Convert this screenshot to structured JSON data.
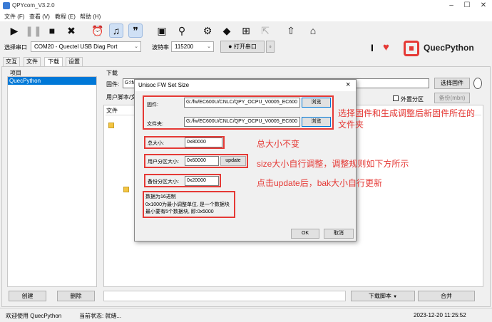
{
  "app": {
    "title": "QPYcom_V3.2.0",
    "window_controls": [
      "minimize-icon",
      "maximize-icon",
      "close-icon"
    ]
  },
  "menu": [
    "文件 (F)",
    "查看 (V)",
    "教程 (E)",
    "帮助 (H)"
  ],
  "toolbar_icons": [
    "play-icon",
    "pause-icon",
    "stop-icon",
    "close-x-icon",
    "alarm-icon",
    "headset-icon",
    "quote-icon",
    "save-icon",
    "search-icon",
    "gear-icon",
    "cube-icon",
    "plus-icon",
    "export-icon",
    "upload-icon",
    "toolbox-icon"
  ],
  "port": {
    "label": "选择串口",
    "value": "COM20 - Quectel USB Diag Port",
    "baud_label": "波特率",
    "baud_value": "115200",
    "open_button": "打开串口"
  },
  "brand": {
    "name": "QuecPython",
    "accent_color": "#e53935"
  },
  "tabs": [
    "交互",
    "文件",
    "下载",
    "设置"
  ],
  "selected_tab": "下载",
  "left_panel": {
    "header": "项目",
    "items": [
      "QuecPython"
    ],
    "create_button": "创建",
    "delete_button": "删除"
  },
  "download_panel": {
    "header": "下载",
    "firmware_label": "固件:",
    "firmware_value": "G:\\fv",
    "select_firmware_button": "选择固件",
    "scripts_label": "用户脚本/文",
    "backup_checkbox": "外置分区",
    "backup_button": "备份(mbn)",
    "file_header": "文件",
    "download_script_button": "下载脚本",
    "merge_button": "合并"
  },
  "dialog": {
    "title": "Unisoc FW Set Size",
    "firmware_label": "固件:",
    "firmware_path": "G:/fw/EC600U/CNLC/QPY_OCPU_V0005_EC600",
    "folder_label": "文件夹:",
    "folder_path": "G:/fw/EC600U/CNLC/QPY_OCPU_V0005_EC600",
    "browse_label": "浏览",
    "total_label": "总大小:",
    "total_value": "0x80000",
    "user_partition_label": "用户分区大小:",
    "user_partition_value": "0x60000",
    "update_button": "update",
    "backup_partition_label": "备份分区大小:",
    "backup_partition_value": "0x20000",
    "note_lines": [
      "数据为16进制",
      "0x1000为最小调整单位, 是一个数据块",
      "最小要有5个数据块, 即:0x5000"
    ],
    "ok_button": "OK",
    "cancel_button": "取消",
    "close_symbol": "×"
  },
  "annotations": {
    "firmware_note": "选择固件和生成调整后新固件所在的",
    "firmware_note_2": "文件夹",
    "total_note": "总大小不变",
    "size_note": "size大小自行调整，调整规则如下方所示",
    "update_note": "点击update后，bak大小自行更新"
  },
  "status": {
    "welcome": "欢迎使用 QuecPython",
    "state_label": "当前状态: 就绪...",
    "datetime": "2023-12-20 11:25:52"
  }
}
